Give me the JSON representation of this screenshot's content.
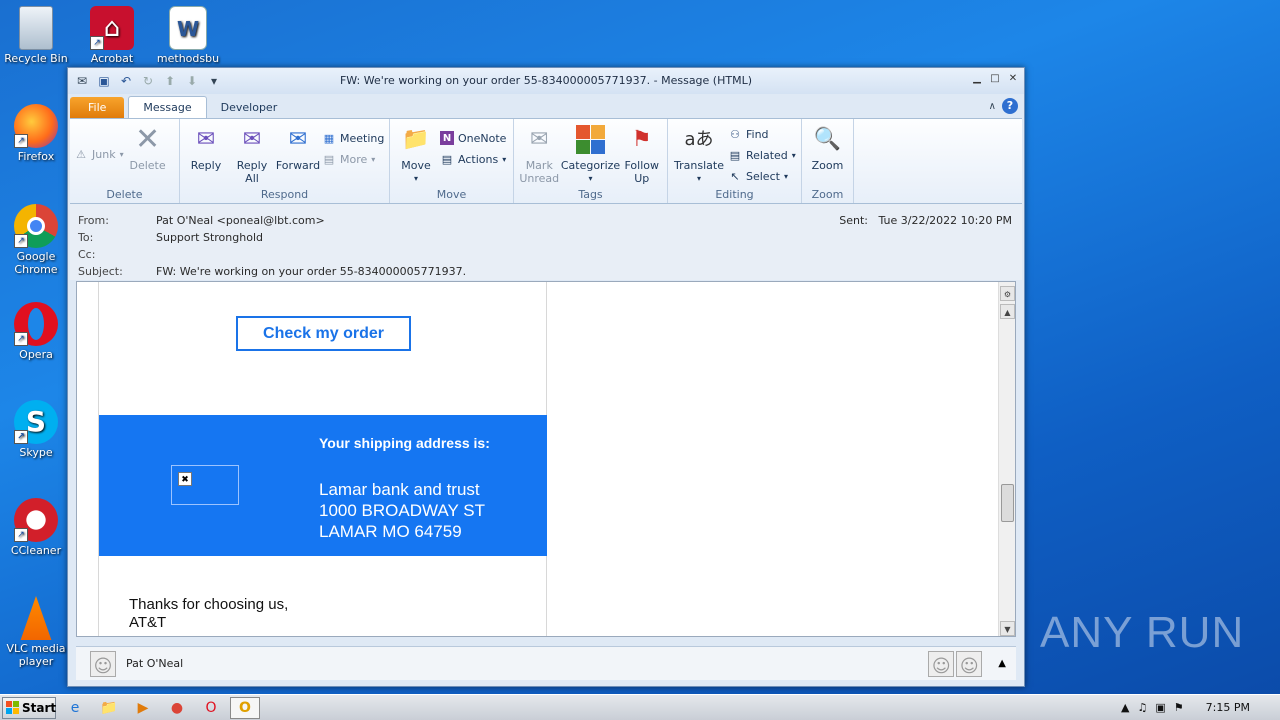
{
  "desktop": {
    "icons": [
      {
        "label": "Recycle Bin",
        "icon": "recycle-bin-icon"
      },
      {
        "label": "Acrobat",
        "icon": "acrobat-icon"
      },
      {
        "label": "methodsbu",
        "icon": "word-document-icon"
      },
      {
        "label": "Firefox",
        "icon": "firefox-icon"
      },
      {
        "label": "Google Chrome",
        "icon": "chrome-icon"
      },
      {
        "label": "Opera",
        "icon": "opera-icon"
      },
      {
        "label": "Skype",
        "icon": "skype-icon"
      },
      {
        "label": "CCleaner",
        "icon": "ccleaner-icon"
      },
      {
        "label": "VLC media player",
        "icon": "vlc-icon"
      }
    ]
  },
  "window": {
    "title": "FW: We're working on your order 55-834000005771937. - Message (HTML)"
  },
  "tabs": [
    {
      "label": "File"
    },
    {
      "label": "Message"
    },
    {
      "label": "Developer"
    }
  ],
  "ribbon": {
    "delete_group": {
      "label": "Delete",
      "junk": "Junk",
      "delete": "Delete"
    },
    "respond_group": {
      "label": "Respond",
      "reply": "Reply",
      "reply_all": "Reply All",
      "forward": "Forward",
      "meeting": "Meeting",
      "more": "More"
    },
    "move_group": {
      "label": "Move",
      "move": "Move",
      "onenote": "OneNote",
      "actions": "Actions"
    },
    "tags_group": {
      "label": "Tags",
      "mark_unread": "Mark Unread",
      "categorize": "Categorize",
      "follow_up": "Follow Up"
    },
    "editing_group": {
      "label": "Editing",
      "translate": "Translate",
      "find": "Find",
      "related": "Related",
      "select": "Select"
    },
    "zoom_group": {
      "label": "Zoom",
      "zoom": "Zoom"
    }
  },
  "header": {
    "from_label": "From:",
    "from_value": "Pat O'Neal <poneal@lbt.com>",
    "to_label": "To:",
    "to_value": "Support Stronghold",
    "cc_label": "Cc:",
    "cc_value": "",
    "subject_label": "Subject:",
    "subject_value": "FW: We're working on your order 55-834000005771937.",
    "sent_label": "Sent:",
    "sent_value": "Tue 3/22/2022 10:20 PM"
  },
  "email": {
    "check_order": "Check my order",
    "shipping_title": "Your shipping address is:",
    "address_line1": "Lamar bank and trust",
    "address_line2": "1000 BROADWAY ST",
    "address_line3": "LAMAR MO 64759",
    "thanks_line1": "Thanks for choosing us,",
    "thanks_line2": "AT&T"
  },
  "people_pane": {
    "name": "Pat O'Neal"
  },
  "taskbar": {
    "start_label": "Start",
    "clock": "7:15 PM"
  },
  "watermark": "ANY RUN"
}
